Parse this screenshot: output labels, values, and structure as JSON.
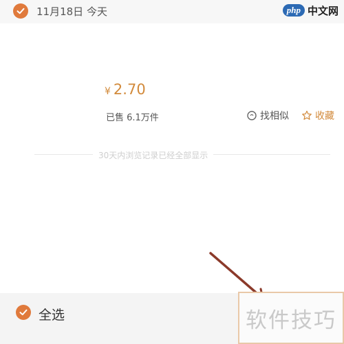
{
  "header": {
    "date": "11月18日 今天"
  },
  "site_logo": {
    "badge": "php",
    "text": "中文网"
  },
  "item": {
    "currency": "¥",
    "price": "2.70",
    "sold": "已售 6.1万件",
    "similar_label": "找相似",
    "favorite_label": "收藏"
  },
  "notice": "30天内浏览记录已经全部显示",
  "footer": {
    "select_all": "全选"
  },
  "watermark": "软件技巧",
  "colors": {
    "accent": "#e07a3c",
    "price": "#d28a3b"
  }
}
